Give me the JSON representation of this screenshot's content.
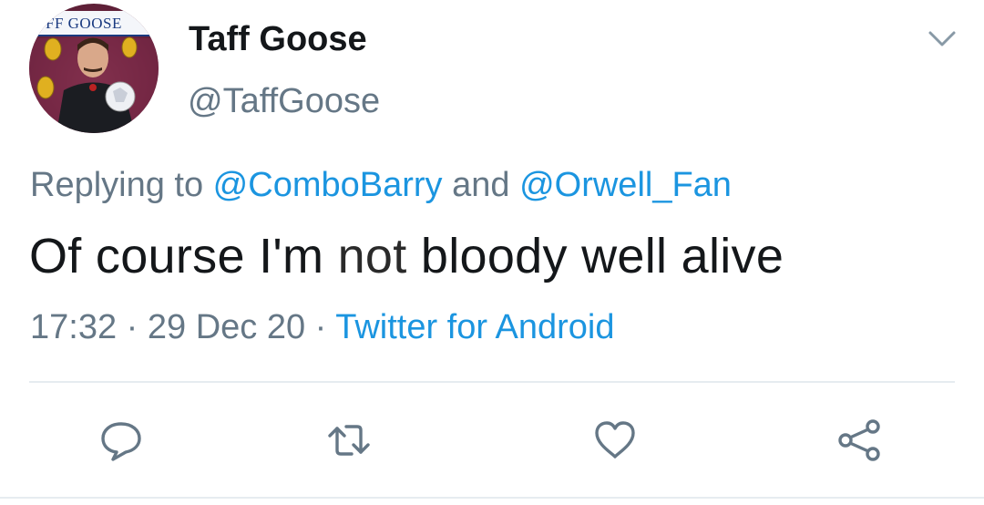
{
  "author": {
    "name": "Taff Goose",
    "handle": "@TaffGoose",
    "avatar_banner_text": "FF GOOSE"
  },
  "reply": {
    "prefix": "Replying to ",
    "user1": "@ComboBarry",
    "conjunction": " and ",
    "user2": "@Orwell_Fan"
  },
  "tweet": {
    "text_before": "Of course I'm ",
    "text_emphasis": "not",
    "text_after": " bloody well alive"
  },
  "meta": {
    "time": "17:32",
    "separator": " · ",
    "date": "29 Dec 20",
    "source": "Twitter for Android"
  },
  "actions": {
    "icons": [
      "reply-icon",
      "retweet-icon",
      "like-icon",
      "share-icon"
    ]
  },
  "colors": {
    "link": "#1b95e0",
    "secondary_text": "#657786",
    "primary_text": "#14171a",
    "divider": "#e6ecf0"
  }
}
